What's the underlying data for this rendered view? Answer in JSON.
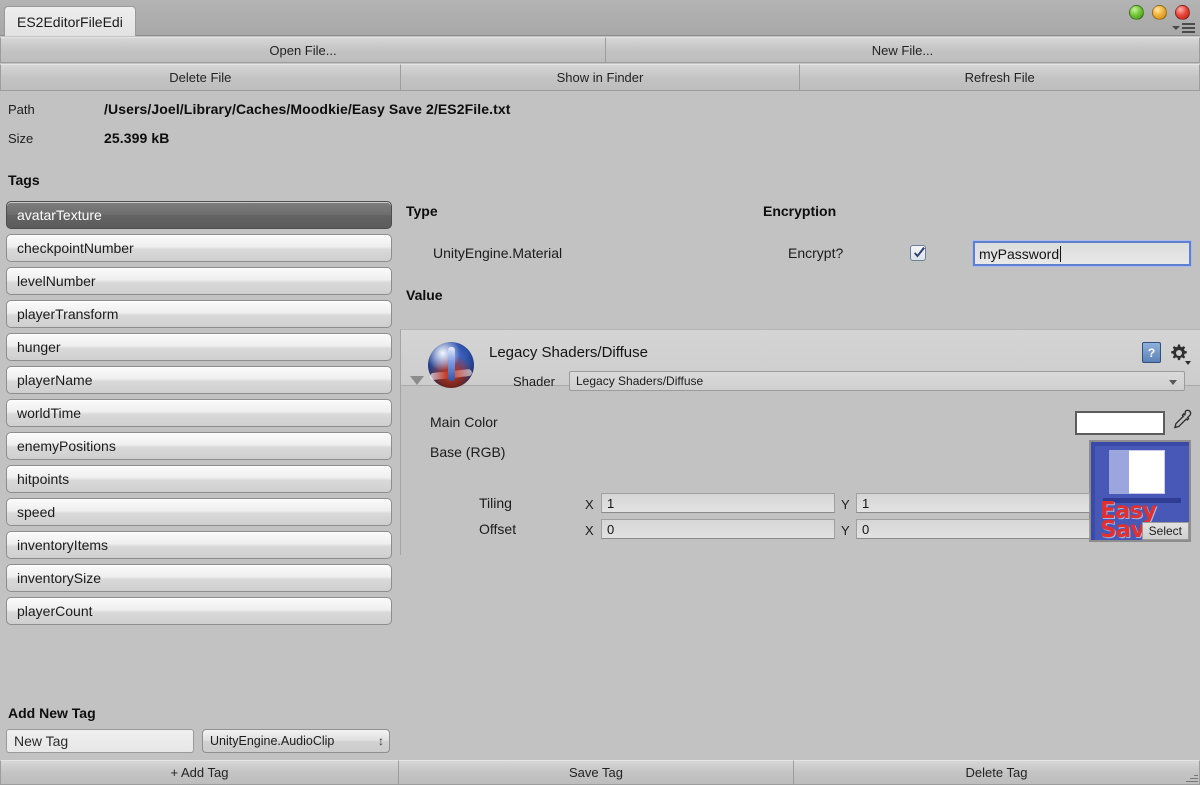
{
  "window": {
    "tab_title": "ES2EditorFileEdi",
    "traffic_lights": [
      "green-light",
      "yellow-light",
      "red-light"
    ],
    "menu_icon": "window-menu-icon"
  },
  "toolbar_row1": [
    {
      "label": "Open File..."
    },
    {
      "label": "New File..."
    }
  ],
  "toolbar_row2": [
    {
      "label": "Delete File"
    },
    {
      "label": "Show in Finder"
    },
    {
      "label": "Refresh File"
    }
  ],
  "file_info": {
    "path_label": "Path",
    "path_value": "/Users/Joel/Library/Caches/Moodkie/Easy Save 2/ES2File.txt",
    "size_label": "Size",
    "size_value": "25.399 kB"
  },
  "tags_section": {
    "heading": "Tags",
    "items": [
      {
        "label": "avatarTexture",
        "selected": true
      },
      {
        "label": "checkpointNumber",
        "selected": false
      },
      {
        "label": "levelNumber",
        "selected": false
      },
      {
        "label": "playerTransform",
        "selected": false
      },
      {
        "label": "hunger",
        "selected": false
      },
      {
        "label": "playerName",
        "selected": false
      },
      {
        "label": "worldTime",
        "selected": false
      },
      {
        "label": "enemyPositions",
        "selected": false
      },
      {
        "label": "hitpoints",
        "selected": false
      },
      {
        "label": "speed",
        "selected": false
      },
      {
        "label": "inventoryItems",
        "selected": false
      },
      {
        "label": "inventorySize",
        "selected": false
      },
      {
        "label": "playerCount",
        "selected": false
      }
    ]
  },
  "type_section": {
    "heading": "Type",
    "value": "UnityEngine.Material"
  },
  "encryption_section": {
    "heading": "Encryption",
    "encrypt_label": "Encrypt?",
    "encrypt_checked": true,
    "password_value": "myPassword",
    "password_focused": true
  },
  "value_section": {
    "heading": "Value",
    "material": {
      "title": "Legacy Shaders/Diffuse",
      "shader_label": "Shader",
      "shader_value": "Legacy Shaders/Diffuse",
      "help_glyph": "?",
      "main_color_label": "Main Color",
      "main_color_hex": "#ffffff",
      "base_rgb_label": "Base (RGB)",
      "texture_logo_line1": "Easy",
      "texture_logo_line2": "Save",
      "texture_select_label": "Select",
      "tiling_label": "Tiling",
      "offset_label": "Offset",
      "x_label": "X",
      "y_label": "Y",
      "tiling_x": "1",
      "tiling_y": "1",
      "offset_x": "0",
      "offset_y": "0"
    }
  },
  "add_new_tag": {
    "heading": "Add New Tag",
    "name_value": "New Tag",
    "type_value": "UnityEngine.AudioClip"
  },
  "bottom_bar": [
    {
      "label": "+ Add Tag"
    },
    {
      "label": "Save Tag"
    },
    {
      "label": "Delete Tag"
    }
  ],
  "colors": {
    "window_bg": "#c2c2c2",
    "selected_tag_bg": "#6e6e6e",
    "focus_border": "#5f7fd0"
  }
}
